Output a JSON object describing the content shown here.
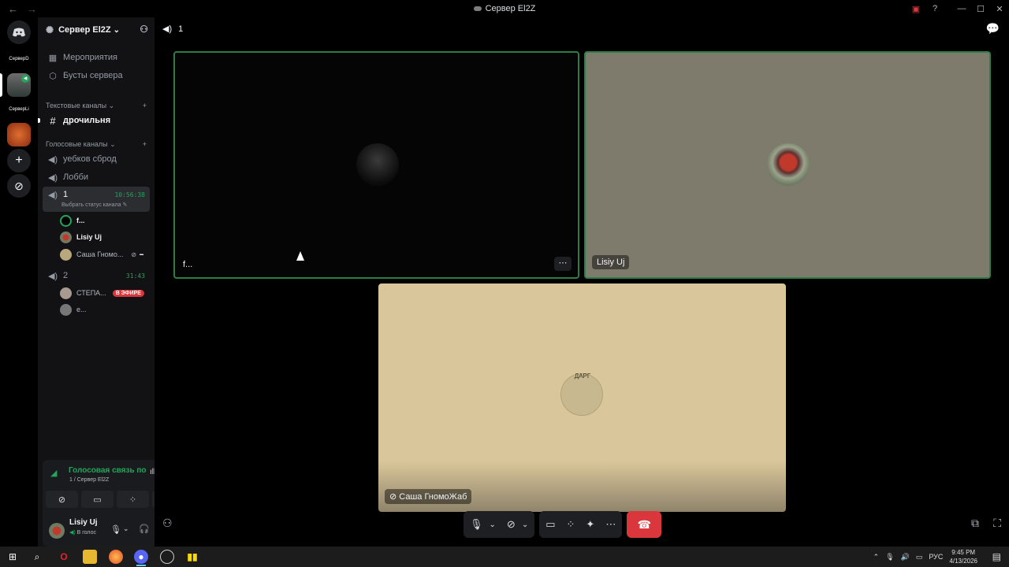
{
  "window": {
    "title": "Сервер El2Z",
    "back": "←",
    "forward": "→"
  },
  "guilds": [
    {
      "label": "СерверD"
    },
    {
      "label": "СерверLi"
    }
  ],
  "server": {
    "name": "Сервер El2Z",
    "chevron": "⌄",
    "items": [
      {
        "label": "Мероприятия"
      },
      {
        "label": "Бусты сервера"
      }
    ],
    "text_category": "Текстовые каналы",
    "text_channels": [
      {
        "label": "дрочильня"
      }
    ],
    "voice_category": "Голосовые каналы",
    "voice_channels": [
      {
        "label": "уебков сброд"
      },
      {
        "label": "Лобби"
      },
      {
        "label": "1",
        "timer": "10:56:38",
        "status_hint": "Выбрать статус канала"
      },
      {
        "label": "2",
        "timer": "31:43"
      }
    ],
    "channel1_users": [
      {
        "name": "f..."
      },
      {
        "name": "Lisiy Uj"
      },
      {
        "name": "Саша Гномо..."
      }
    ],
    "channel2_users": [
      {
        "name": "СТЕПА...",
        "badge": "В ЭФИРЕ"
      },
      {
        "name": "e..."
      }
    ]
  },
  "voice_panel": {
    "status": "Голосовая связь по",
    "location": "1 / Сервер El2Z"
  },
  "user_panel": {
    "name": "Lisiy Uj",
    "status": "В голос"
  },
  "call": {
    "channel": "1",
    "tiles": [
      {
        "name": "f...",
        "bg": "#050505"
      },
      {
        "name": "Lisiy Uj",
        "bg": "#7e7b6d"
      },
      {
        "name": "Саша ГномоЖаб",
        "bg": "#d9c69a"
      }
    ],
    "tile3_avatar_text": "ДАРГ"
  },
  "taskbar": {
    "lang": "РУС",
    "time": "9:45 PM",
    "date": "4/13/2026"
  },
  "colors": {
    "green": "#23a55a",
    "red": "#da373c",
    "speaking_border": "#2d7d46"
  }
}
